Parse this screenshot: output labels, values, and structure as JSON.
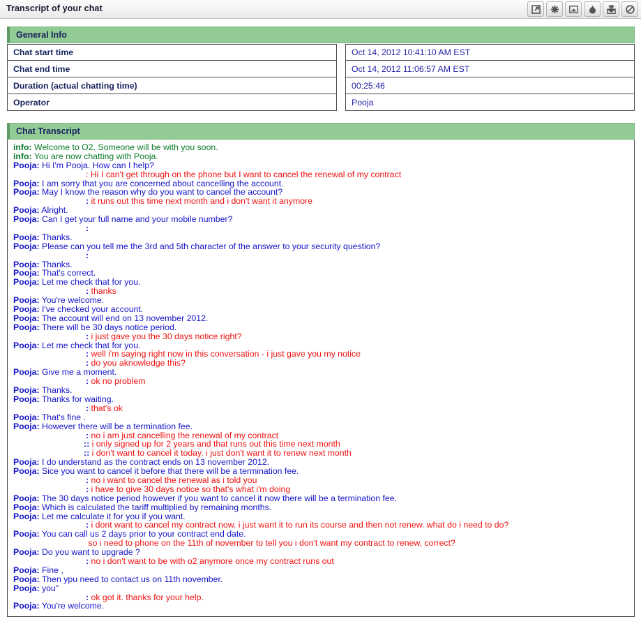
{
  "window": {
    "title": "Transcript of your chat",
    "toolbar": [
      {
        "name": "popout-icon",
        "label": "Open in new window"
      },
      {
        "name": "asterisk-icon",
        "label": "Highlight"
      },
      {
        "name": "image-icon",
        "label": "Save as image"
      },
      {
        "name": "flame-icon",
        "label": "Burn"
      },
      {
        "name": "mail-icon",
        "label": "Email transcript"
      },
      {
        "name": "block-icon",
        "label": "Block"
      }
    ]
  },
  "general_info": {
    "heading": "General Info",
    "rows": [
      {
        "label": "Chat start time",
        "value": "Oct 14, 2012 10:41:10 AM EST"
      },
      {
        "label": "Chat end time",
        "value": "Oct 14, 2012 11:06:57 AM EST"
      },
      {
        "label": "Duration (actual chatting time)",
        "value": "00:25:46"
      },
      {
        "label": "Operator",
        "value": "Pooja"
      }
    ]
  },
  "chat": {
    "heading": "Chat Transcript",
    "info_label": "info:",
    "operator_label": "Pooja:",
    "messages": [
      {
        "type": "info",
        "text": "Welcome to O2. Someone will be with you soon."
      },
      {
        "type": "info",
        "text": "You are now chatting with Pooja."
      },
      {
        "type": "op",
        "text": "Hi I'm Pooja. How can I help?"
      },
      {
        "type": "cust",
        "colon": "red",
        "text": "Hi I can't get through on the phone but I want to cancel the renewal of my contract"
      },
      {
        "type": "op",
        "text": "I am sorry that you are concerned about cancelling the account."
      },
      {
        "type": "op",
        "text": "May I know the reason why do you want to cancel the account?"
      },
      {
        "type": "cust",
        "colon": "blue",
        "text": "it runs out this time next month and i don't want it anymore"
      },
      {
        "type": "op",
        "text": "Alright."
      },
      {
        "type": "op",
        "text": "Can I get your full name and your mobile number?"
      },
      {
        "type": "cust",
        "colon": "blue",
        "text": ""
      },
      {
        "type": "op",
        "text": "Thanks."
      },
      {
        "type": "op",
        "text": "Please can you tell me the 3rd and 5th character of the answer to your security question?"
      },
      {
        "type": "cust",
        "colon": "blue",
        "text": ""
      },
      {
        "type": "op",
        "text": "Thanks."
      },
      {
        "type": "op",
        "text": "That's correct."
      },
      {
        "type": "op",
        "text": "Let me check that for you."
      },
      {
        "type": "cust",
        "colon": "blue",
        "text": "thanks"
      },
      {
        "type": "op",
        "text": "You're welcome."
      },
      {
        "type": "op",
        "text": "I've checked your account."
      },
      {
        "type": "op",
        "text": "The account will end on 13 november 2012."
      },
      {
        "type": "op",
        "text": "There will be 30 days notice period."
      },
      {
        "type": "cust",
        "colon": "blue",
        "text": "i just gave you the 30 days notice right?"
      },
      {
        "type": "op",
        "text": "Let me check that for you."
      },
      {
        "type": "cust",
        "colon": "blue",
        "text": "well i'm saying right now in this conversation - i just gave you my notice"
      },
      {
        "type": "cust",
        "colon": "blue",
        "text": "do you aknowledge this?"
      },
      {
        "type": "op",
        "text": "Give me a moment."
      },
      {
        "type": "cust",
        "colon": "blue",
        "text": "ok no problem"
      },
      {
        "type": "op",
        "text": "Thanks."
      },
      {
        "type": "op",
        "text": "Thanks for waiting."
      },
      {
        "type": "cust",
        "colon": "blue",
        "text": "that's ok"
      },
      {
        "type": "op",
        "text": "That's fine ."
      },
      {
        "type": "op",
        "text": "However there will be a termination fee."
      },
      {
        "type": "cust",
        "colon": "blue",
        "text": "no i am just cancelling the renewal of my contract"
      },
      {
        "type": "cust",
        "colon": "double",
        "text": "i only signed up for 2 years and that runs out this time next month"
      },
      {
        "type": "cust",
        "colon": "double",
        "text": "i don't want to cancel it today. i just don't want it to renew next month"
      },
      {
        "type": "op",
        "text": "I do understand as the contract ends on 13 november 2012."
      },
      {
        "type": "op",
        "text": "Sice you want to cancel it before that there will be a termination fee."
      },
      {
        "type": "cust",
        "colon": "blue",
        "text": "no i want to cancel the renewal as i told you"
      },
      {
        "type": "cust",
        "colon": "blue",
        "text": "i have to give 30 days notice so that's what i'm doing"
      },
      {
        "type": "op",
        "text": "The 30 days notice period however if you want to cancel it now there will be a termination fee."
      },
      {
        "type": "op",
        "text": "Which is calculated the tariff multiplied by remaining months."
      },
      {
        "type": "op",
        "text": "Let me calculate it for you if you want."
      },
      {
        "type": "cust",
        "colon": "blue",
        "text": "i dont want to cancel my contract now. i just want it to run its course and then not renew. what do i need to do?"
      },
      {
        "type": "op",
        "text": "You can call us 2 days prior to your contract end date."
      },
      {
        "type": "cust",
        "colon": "none",
        "text": "so i need to phone on the 11th of november to tell you i don't want my contract to renew, correct?"
      },
      {
        "type": "op",
        "text": "Do you want to upgrade ?"
      },
      {
        "type": "cust",
        "colon": "blue",
        "text": "no i don't want to be with o2 anymore once my contract runs out"
      },
      {
        "type": "op",
        "text": "Fine ,"
      },
      {
        "type": "op",
        "text": "Then ypu need to contact us on 11th november."
      },
      {
        "type": "op",
        "text": "you\""
      },
      {
        "type": "cust",
        "colon": "blue",
        "text": "ok got it. thanks for your help."
      },
      {
        "type": "op",
        "text": "You're welcome."
      }
    ]
  },
  "colors": {
    "panel_green": "#93cb95",
    "operator_blue": "#1414c8",
    "customer_red": "#ee1111",
    "info_green": "#0a7a2a",
    "heading_navy": "#16235c"
  }
}
